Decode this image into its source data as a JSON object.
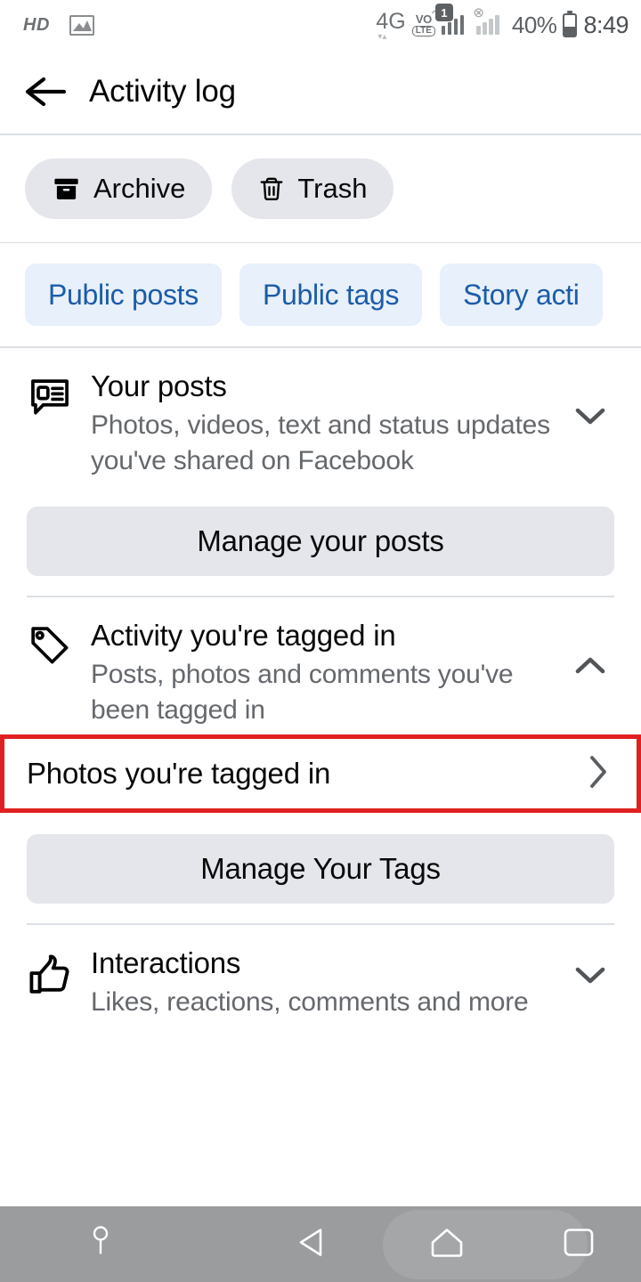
{
  "status_bar": {
    "hd_label": "HD",
    "screenshot_icon": "picture-icon",
    "network_type": "4G",
    "volte_vo": "VO",
    "volte_lte": "LTE",
    "sim1_badge": "1",
    "sim2_state": "disabled",
    "battery_percent": "40%",
    "time": "8:49"
  },
  "header": {
    "back_icon": "back-arrow-icon",
    "title": "Activity log"
  },
  "actions": [
    {
      "label": "Archive",
      "icon": "archive-box-icon"
    },
    {
      "label": "Trash",
      "icon": "trash-can-icon"
    }
  ],
  "filters": [
    {
      "label": "Public posts"
    },
    {
      "label": "Public tags"
    },
    {
      "label": "Story acti"
    }
  ],
  "sections": [
    {
      "id": "your-posts",
      "icon": "post-bubble-icon",
      "title": "Your posts",
      "subtitle": "Photos, videos, text and status updates you've shared on Facebook",
      "chevron": "chevron-down-icon",
      "expanded": false,
      "button": "Manage your posts"
    },
    {
      "id": "activity-tagged-in",
      "icon": "tag-icon",
      "title": "Activity you're tagged in",
      "subtitle": "Posts, photos and comments you've been tagged in",
      "chevron": "chevron-up-icon",
      "expanded": true,
      "sub_row": {
        "label": "Photos you're tagged in",
        "chevron": "chevron-right-icon",
        "highlighted": true
      },
      "button": "Manage Your Tags"
    },
    {
      "id": "interactions",
      "icon": "thumbs-up-icon",
      "title": "Interactions",
      "subtitle": "Likes, reactions, comments and more",
      "chevron": "chevron-down-icon",
      "expanded": false
    }
  ],
  "navbar": {
    "assistant_icon": "assistant-icon",
    "back_icon": "nav-back-icon",
    "home_icon": "nav-home-icon",
    "recents_icon": "nav-recents-icon"
  },
  "colors": {
    "accent_blue": "#1c5ca8",
    "chip_blue_bg": "#e7f0fb",
    "chip_gray_bg": "#e4e6eb",
    "highlight_red": "#e02020",
    "text_primary": "#080809",
    "text_secondary": "#65686c"
  }
}
